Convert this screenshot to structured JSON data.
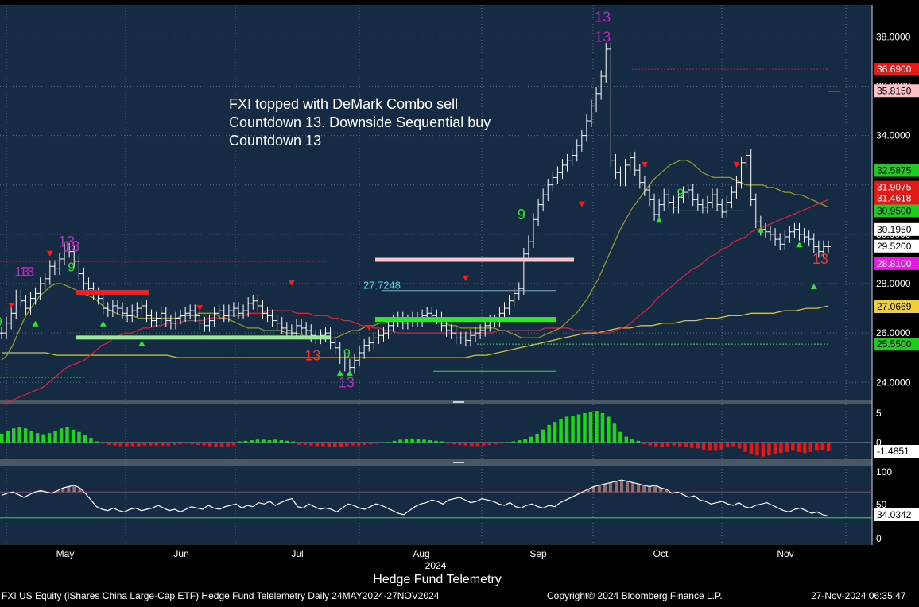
{
  "colors": {
    "background": "#152a43",
    "price_bar": "#ffffff",
    "ma_short": "#8f9a2a",
    "ma_mid": "#d9223a",
    "ma_long": "#d6c531",
    "osc_up": "#1fd31f",
    "osc_down": "#e01919",
    "sell_arrow": "#ff1a1a",
    "buy_arrow": "#2ee62e",
    "countdown_label": "#c02cc0",
    "green_label": "#2ee62e",
    "red_label": "#ff3030"
  },
  "annotation": "FXI topped with DeMark Combo sell\nCountdown 13. Downside Sequential buy\nCountdown 13",
  "chart_title": "Hedge Fund Telemetry",
  "footer": {
    "security": "FXI US Equity (iShares China Large-Cap ETF) Hedge Fund Telelemetry  Daily 24MAY2024-27NOV2024",
    "copyright": "Copyright© 2024 Bloomberg Finance L.P.",
    "timestamp": "27-Nov-2024 06:35:47"
  },
  "chart_data": [
    {
      "type": "ohlc",
      "panel": "price",
      "yticks": [
        "24.0000",
        "26.0000",
        "28.0000",
        "30.0000",
        "32.0000",
        "34.0000",
        "36.0000",
        "38.0000"
      ],
      "ylim": [
        23.3,
        39.3
      ],
      "x_month_labels": [
        "May",
        "Jun",
        "Jul",
        "Aug",
        "Sep",
        "Oct",
        "Nov"
      ],
      "x_year_label": "2024",
      "price_tags": [
        {
          "label": "36.6900",
          "value": 36.69,
          "bg": "#e51b1b",
          "fg": "#ffffff"
        },
        {
          "label": "35.8150",
          "value": 35.815,
          "bg": "#ffc0c8",
          "fg": "#000000"
        },
        {
          "label": "32.5875",
          "value": 32.5875,
          "bg": "#22c922",
          "fg": "#000000"
        },
        {
          "label": "31.9075",
          "value": 31.9075,
          "bg": "#e01919",
          "fg": "#ffffff"
        },
        {
          "label": "31.4618",
          "value": 31.4618,
          "bg": "#e01919",
          "fg": "#ffffff"
        },
        {
          "label": "30.9500",
          "value": 30.95,
          "bg": "#22c922",
          "fg": "#000000"
        },
        {
          "label": "30.1950",
          "value": 30.195,
          "bg": "#ffffff",
          "fg": "#000000"
        },
        {
          "label": "29.5200",
          "value": 29.52,
          "bg": "#ffffff",
          "fg": "#000000"
        },
        {
          "label": "28.8100",
          "value": 28.81,
          "bg": "#e11de1",
          "fg": "#ffffff"
        },
        {
          "label": "27.0669",
          "value": 27.0669,
          "bg": "#f0d03a",
          "fg": "#000000"
        },
        {
          "label": "25.5500",
          "value": 25.55,
          "bg": "#22c922",
          "fg": "#000000"
        }
      ],
      "level_labels": [
        {
          "label": "27.7248",
          "value": 27.7248
        }
      ],
      "closes": [
        26.0,
        26.4,
        26.8,
        27.5,
        27.3,
        27.0,
        27.4,
        27.6,
        28.0,
        28.2,
        28.7,
        28.6,
        29.0,
        29.4,
        29.3,
        28.9,
        28.4,
        28.0,
        27.8,
        27.6,
        27.4,
        27.0,
        26.9,
        27.1,
        27.0,
        26.8,
        26.7,
        26.9,
        27.0,
        27.1,
        26.7,
        26.5,
        26.6,
        26.8,
        26.5,
        26.4,
        26.6,
        26.7,
        26.8,
        26.9,
        26.7,
        26.4,
        26.3,
        26.5,
        26.8,
        26.9,
        26.7,
        26.9,
        27.0,
        26.8,
        26.9,
        27.2,
        27.3,
        27.1,
        26.8,
        26.7,
        26.5,
        26.4,
        26.2,
        26.1,
        26.0,
        26.3,
        26.2,
        26.1,
        25.9,
        25.8,
        25.9,
        26.0,
        25.6,
        25.4,
        25.0,
        24.7,
        24.6,
        24.9,
        25.2,
        25.5,
        25.6,
        25.8,
        25.9,
        26.0,
        26.3,
        26.5,
        26.6,
        26.4,
        26.5,
        26.6,
        26.5,
        26.7,
        26.8,
        26.7,
        26.6,
        26.3,
        26.1,
        26.0,
        25.8,
        25.8,
        25.7,
        25.9,
        26.0,
        26.1,
        26.3,
        26.5,
        26.5,
        26.8,
        27.0,
        27.3,
        27.6,
        27.8,
        29.2,
        29.7,
        30.6,
        31.2,
        31.6,
        32.0,
        32.3,
        32.5,
        32.8,
        33.0,
        33.2,
        33.6,
        34.0,
        34.6,
        35.2,
        35.7,
        36.4,
        37.5,
        33.0,
        32.5,
        32.2,
        32.8,
        33.1,
        32.6,
        32.1,
        31.8,
        31.4,
        30.8,
        31.2,
        31.6,
        31.3,
        31.1,
        31.5,
        31.7,
        31.8,
        31.4,
        31.2,
        31.1,
        31.3,
        31.6,
        31.2,
        30.9,
        31.3,
        31.7,
        32.1,
        32.9,
        33.2,
        31.4,
        30.5,
        30.2,
        30.1,
        30.0,
        29.8,
        29.6,
        29.9,
        30.1,
        30.2,
        30.0,
        29.9,
        29.8,
        29.5,
        29.3,
        29.5,
        29.5
      ],
      "ma_short": [
        24.9,
        25.1,
        25.5,
        26.0,
        26.5,
        26.9,
        27.2,
        27.5,
        27.7,
        27.9,
        28.0,
        28.0,
        27.9,
        27.8,
        27.7,
        27.6,
        27.5,
        27.4,
        27.2,
        27.0,
        26.9,
        26.8,
        26.7,
        26.7,
        26.7,
        26.6,
        26.6,
        26.6,
        26.6,
        26.6,
        26.6,
        26.6,
        26.6,
        26.7,
        26.7,
        26.7,
        26.8,
        26.8,
        26.8,
        26.8,
        26.6,
        26.6,
        26.5,
        26.4,
        26.3,
        26.2,
        26.2,
        26.2,
        26.1,
        26.1,
        26.1,
        26.1,
        26.0,
        26.0,
        26.0,
        25.9,
        25.8,
        25.8,
        25.8,
        25.8,
        25.8,
        25.8,
        25.9,
        26.0,
        26.1,
        26.1,
        26.2,
        26.3,
        26.3,
        26.4,
        26.4,
        26.5,
        26.5,
        26.5,
        26.6,
        26.6,
        26.6,
        26.6,
        26.5,
        26.5,
        26.4,
        26.4,
        26.3,
        26.3,
        26.2,
        26.2,
        26.2,
        26.2,
        26.2,
        26.2,
        26.2,
        26.1,
        26.1,
        26.0,
        25.9,
        25.8,
        25.8,
        25.8,
        25.8,
        25.9,
        26.0,
        26.1,
        26.2,
        26.4,
        26.6,
        26.8,
        27.1,
        27.4,
        27.8,
        28.2,
        28.7,
        29.2,
        29.7,
        30.2,
        30.6,
        31.0,
        31.3,
        31.6,
        31.9,
        32.2,
        32.4,
        32.6,
        32.8,
        32.9,
        33.0,
        33.0,
        32.9,
        32.7,
        32.5,
        32.4,
        32.3,
        32.3,
        32.3,
        32.3,
        32.2,
        32.1,
        32.0,
        32.0,
        32.0,
        32.0,
        31.9,
        31.9,
        31.8,
        31.7,
        31.7,
        31.6,
        31.6,
        31.5,
        31.4,
        31.3,
        31.2,
        31.1
      ],
      "ma_mid": [
        23.1,
        23.2,
        23.3,
        23.4,
        23.5,
        23.6,
        23.7,
        23.8,
        24.0,
        24.2,
        24.4,
        24.6,
        24.7,
        24.8,
        24.9,
        25.1,
        25.3,
        25.5,
        25.6,
        25.8,
        25.9,
        26.0,
        26.0,
        26.1,
        26.2,
        26.2,
        26.3,
        26.3,
        26.4,
        26.4,
        26.4,
        26.5,
        26.5,
        26.5,
        26.5,
        26.6,
        26.6,
        26.6,
        26.7,
        26.7,
        26.7,
        26.7,
        26.8,
        26.8,
        26.8,
        26.9,
        26.9,
        26.9,
        26.9,
        26.9,
        26.8,
        26.8,
        26.8,
        26.7,
        26.7,
        26.7,
        26.6,
        26.6,
        26.5,
        26.5,
        26.4,
        26.3,
        26.3,
        26.2,
        26.2,
        26.1,
        26.1,
        26.0,
        26.0,
        26.0,
        26.0,
        26.0,
        26.0,
        26.0,
        26.0,
        26.0,
        26.0,
        26.0,
        26.0,
        26.0,
        26.0,
        26.0,
        26.0,
        26.0,
        26.1,
        26.1,
        26.1,
        26.1,
        26.1,
        26.1,
        26.1,
        26.1,
        26.2,
        26.2,
        26.2,
        26.2,
        26.2,
        26.1,
        26.1,
        26.1,
        26.1,
        26.0,
        26.0,
        26.0,
        26.1,
        26.2,
        26.3,
        26.5,
        26.7,
        26.9,
        27.1,
        27.4,
        27.6,
        27.8,
        28.0,
        28.2,
        28.4,
        28.6,
        28.7,
        28.9,
        29.1,
        29.2,
        29.4,
        29.5,
        29.7,
        29.8,
        29.9,
        30.1,
        30.2,
        30.3,
        30.4,
        30.5,
        30.6,
        30.7,
        30.8,
        30.9,
        31.0,
        31.1,
        31.2,
        31.3,
        31.4
      ],
      "ma_long": [
        25.2,
        25.2,
        25.2,
        25.2,
        25.2,
        25.1,
        25.1,
        25.1,
        25.1,
        25.1,
        25.1,
        25.1,
        25.1,
        25.1,
        25.1,
        25.1,
        25.0,
        25.0,
        25.0,
        25.0,
        25.0,
        25.0,
        25.0,
        25.0,
        25.0,
        25.0,
        25.0,
        25.0,
        25.0,
        25.0,
        25.0,
        25.0,
        25.0,
        25.0,
        25.0,
        25.0,
        25.0,
        25.0,
        25.0,
        25.0,
        25.0,
        25.0,
        25.0,
        25.1,
        25.1,
        25.2,
        25.3,
        25.4,
        25.5,
        25.6,
        25.7,
        25.8,
        25.9,
        26.0,
        26.0,
        26.1,
        26.2,
        26.2,
        26.3,
        26.3,
        26.4,
        26.4,
        26.5,
        26.5,
        26.6,
        26.6,
        26.7,
        26.7,
        26.8,
        26.8,
        26.8,
        26.9,
        26.9,
        27.0,
        27.0,
        27.1
      ]
    },
    {
      "type": "bar",
      "panel": "oscillator",
      "yticks": [
        "5",
        "0"
      ],
      "last_value_label": "-1.4851",
      "values": [
        1.5,
        2.0,
        2.4,
        2.6,
        2.4,
        2.0,
        1.6,
        1.4,
        1.6,
        2.0,
        2.4,
        2.6,
        2.2,
        1.8,
        1.3,
        0.8,
        0.2,
        -0.2,
        -0.4,
        -0.5,
        -0.6,
        -0.6,
        -0.6,
        -0.6,
        -0.5,
        -0.5,
        -0.5,
        -0.5,
        -0.5,
        -0.4,
        -0.3,
        -0.2,
        -0.3,
        -0.4,
        -0.5,
        -0.6,
        -0.7,
        -0.7,
        -0.6,
        -0.5,
        0.2,
        0.3,
        0.4,
        0.5,
        0.5,
        0.4,
        0.5,
        0.4,
        0.3,
        0.2,
        -0.4,
        -0.4,
        -0.5,
        -0.6,
        -0.6,
        -0.7,
        -0.8,
        -0.7,
        -0.6,
        -0.5,
        -0.5,
        -0.4,
        -0.3,
        -0.2,
        -0.1,
        0.1,
        0.3,
        0.5,
        0.6,
        0.7,
        0.6,
        0.5,
        0.4,
        0.3,
        0.2,
        -0.2,
        -0.3,
        -0.4,
        -0.5,
        -0.6,
        -0.6,
        -0.5,
        -0.4,
        -0.3,
        -0.2,
        0.1,
        0.2,
        0.4,
        0.6,
        1.0,
        1.5,
        2.2,
        3.0,
        3.5,
        4.0,
        4.4,
        4.6,
        4.8,
        5.0,
        5.2,
        5.4,
        5.0,
        4.4,
        3.2,
        1.8,
        1.0,
        0.6,
        0.3,
        -0.3,
        -0.5,
        -0.6,
        -0.7,
        -0.6,
        -0.5,
        -0.6,
        -0.8,
        -0.9,
        -1.0,
        -1.2,
        -1.4,
        -1.4,
        -1.2,
        -0.8,
        -0.6,
        -1.0,
        -1.6,
        -2.0,
        -2.2,
        -2.4,
        -2.2,
        -2.0,
        -1.8,
        -1.6,
        -1.4,
        -1.6,
        -1.8,
        -1.6,
        -1.4,
        -1.3,
        -1.5
      ]
    },
    {
      "type": "line",
      "panel": "rsi",
      "yticks": [
        "100",
        "50",
        "0"
      ],
      "ylim": [
        0,
        100
      ],
      "last_value_label": "34.0342",
      "values": [
        65,
        68,
        70,
        66,
        62,
        66,
        70,
        72,
        70,
        68,
        72,
        76,
        78,
        80,
        76,
        68,
        58,
        48,
        44,
        42,
        46,
        42,
        40,
        44,
        46,
        42,
        44,
        46,
        50,
        46,
        42,
        44,
        40,
        44,
        48,
        46,
        44,
        50,
        46,
        44,
        48,
        50,
        52,
        46,
        50,
        48,
        54,
        52,
        56,
        50,
        54,
        58,
        60,
        48,
        46,
        52,
        48,
        44,
        46,
        44,
        40,
        46,
        52,
        50,
        46,
        44,
        48,
        52,
        50,
        46,
        42,
        38,
        36,
        42,
        48,
        52,
        54,
        58,
        56,
        52,
        58,
        60,
        62,
        58,
        54,
        56,
        60,
        58,
        56,
        52,
        50,
        54,
        48,
        46,
        50,
        52,
        48,
        46,
        50,
        48,
        54,
        58,
        62,
        66,
        70,
        74,
        78,
        80,
        82,
        84,
        86,
        88,
        86,
        84,
        82,
        80,
        78,
        80,
        76,
        74,
        68,
        70,
        66,
        62,
        64,
        58,
        56,
        52,
        54,
        56,
        52,
        50,
        54,
        48,
        46,
        50,
        52,
        54,
        50,
        46,
        42,
        40,
        44,
        46,
        42,
        38,
        40,
        36,
        34
      ],
      "levels": [
        70,
        30
      ]
    }
  ]
}
